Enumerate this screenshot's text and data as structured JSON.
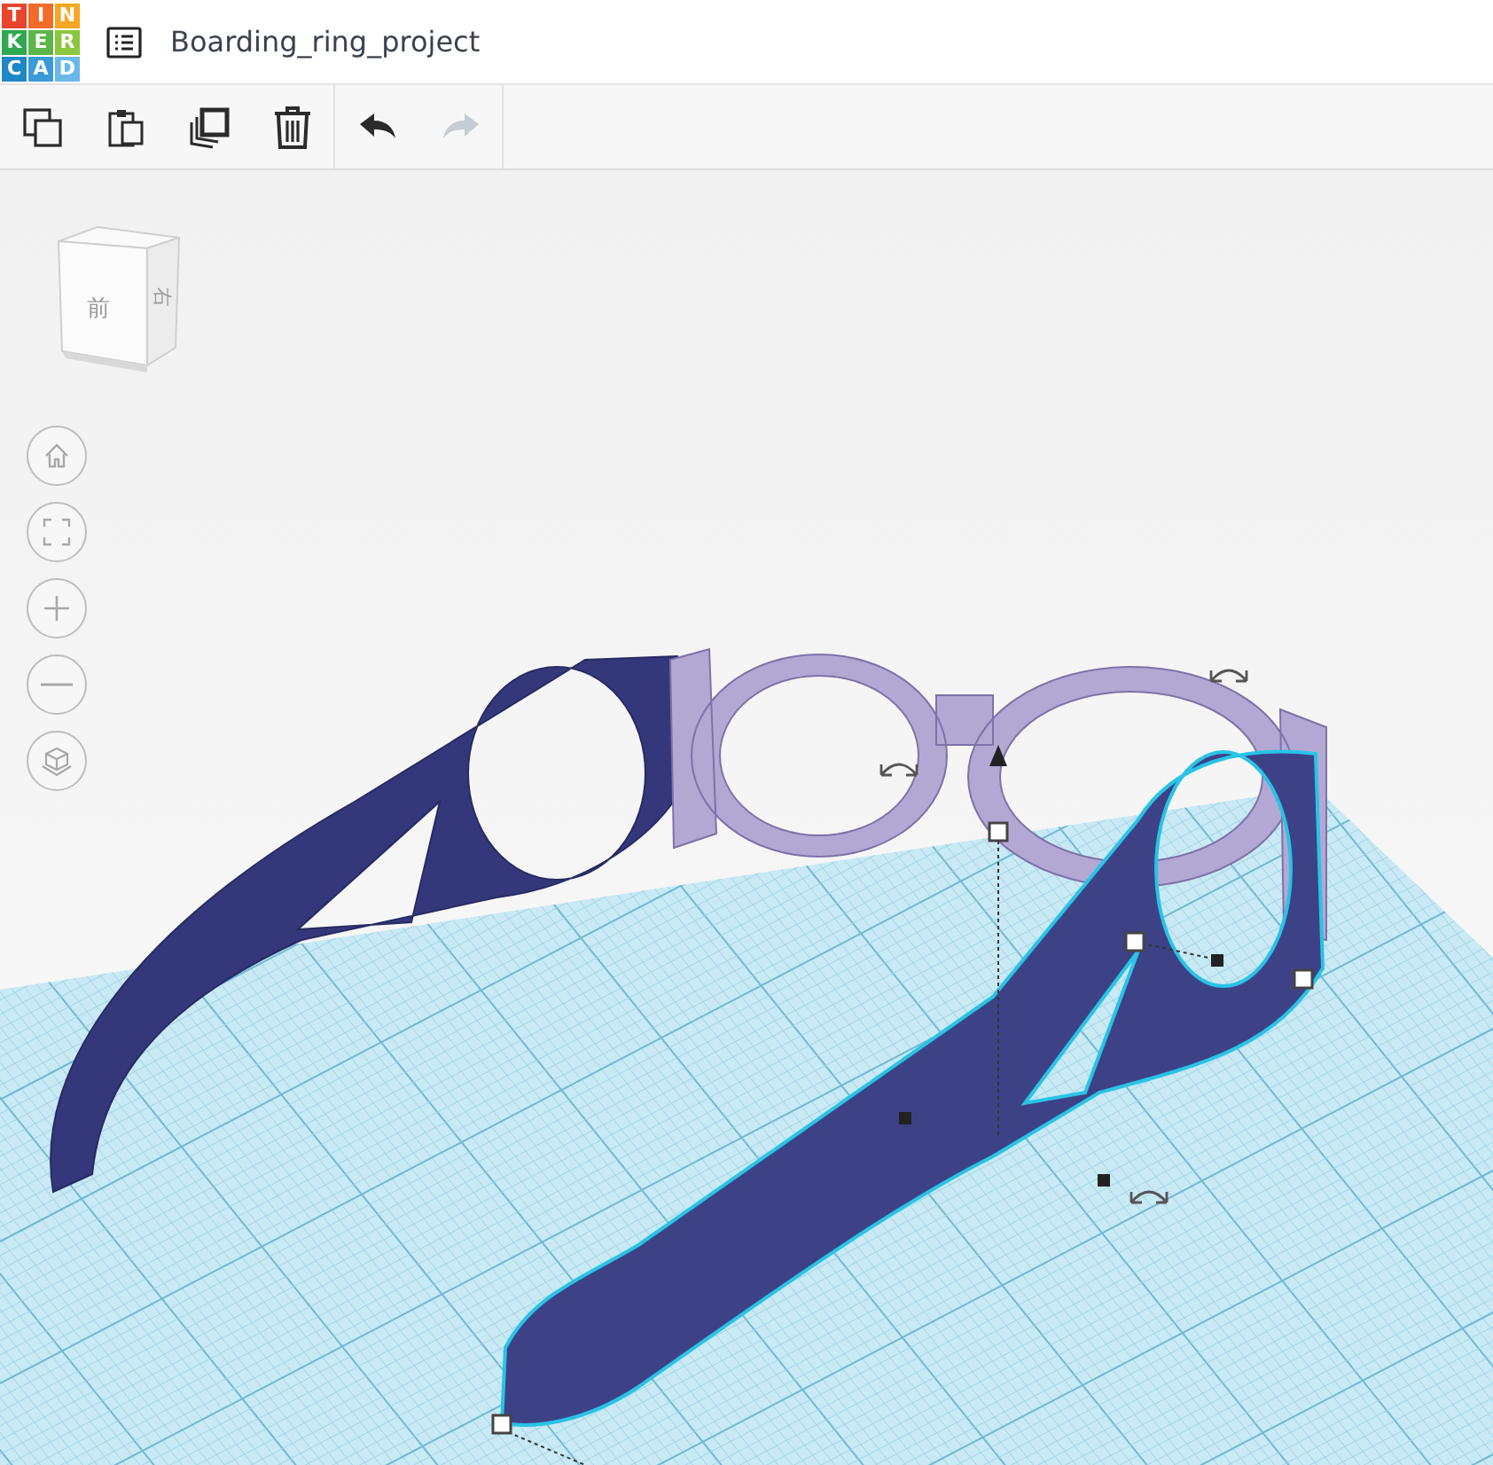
{
  "header": {
    "logo": [
      {
        "letter": "T",
        "color": "#e8442e"
      },
      {
        "letter": "I",
        "color": "#f26b2a"
      },
      {
        "letter": "N",
        "color": "#f5a623"
      },
      {
        "letter": "K",
        "color": "#2fa84f"
      },
      {
        "letter": "E",
        "color": "#5cb548"
      },
      {
        "letter": "R",
        "color": "#8cc63f"
      },
      {
        "letter": "C",
        "color": "#1e88c7"
      },
      {
        "letter": "A",
        "color": "#3a9bd9"
      },
      {
        "letter": "D",
        "color": "#6bb8e8"
      }
    ],
    "title": "Boarding_ring_project"
  },
  "toolbar": {
    "groups": [
      [
        {
          "kind": "copy",
          "disabled": false
        },
        {
          "kind": "paste",
          "disabled": false
        },
        {
          "kind": "duplicate",
          "disabled": false
        },
        {
          "kind": "delete",
          "disabled": false
        }
      ],
      [
        {
          "kind": "undo",
          "disabled": false
        },
        {
          "kind": "redo",
          "disabled": true
        }
      ]
    ]
  },
  "view_cube": {
    "front": "前",
    "right": "右"
  },
  "view_controls": [
    {
      "kind": "home"
    },
    {
      "kind": "fit"
    },
    {
      "kind": "zoom_in"
    },
    {
      "kind": "zoom_out"
    },
    {
      "kind": "perspective"
    }
  ]
}
